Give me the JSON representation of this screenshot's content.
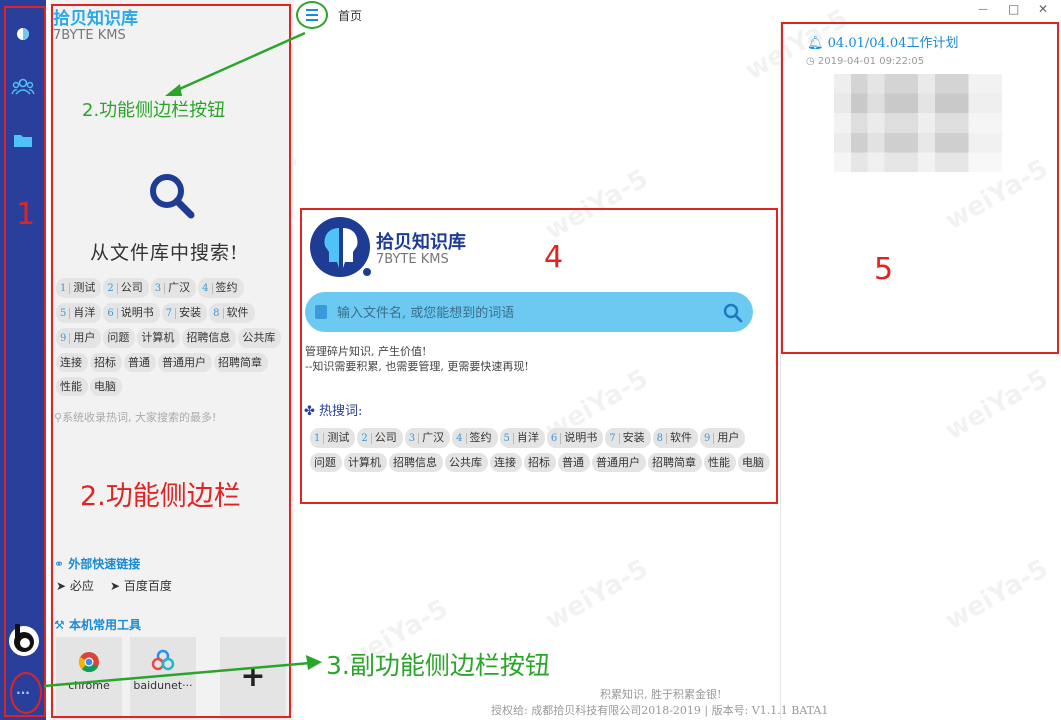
{
  "rail": {
    "icons": [
      "brain-icon",
      "users-icon",
      "folder-icon"
    ],
    "number": "1",
    "more_label": "···"
  },
  "panel": {
    "app_title": "拾贝知识库",
    "app_subtitle": "7BYTE KMS",
    "search_title": "从文件库中搜索!",
    "tags": [
      {
        "n": "1",
        "t": "测试"
      },
      {
        "n": "2",
        "t": "公司"
      },
      {
        "n": "3",
        "t": "广汉"
      },
      {
        "n": "4",
        "t": "签约"
      },
      {
        "n": "5",
        "t": "肖洋"
      },
      {
        "n": "6",
        "t": "说明书"
      },
      {
        "n": "7",
        "t": "安装"
      },
      {
        "n": "8",
        "t": "软件"
      },
      {
        "n": "9",
        "t": "用户"
      },
      {
        "n": "",
        "t": "问题"
      },
      {
        "n": "",
        "t": "计算机"
      },
      {
        "n": "",
        "t": "招聘信息"
      },
      {
        "n": "",
        "t": "公共库"
      },
      {
        "n": "",
        "t": "连接"
      },
      {
        "n": "",
        "t": "招标"
      },
      {
        "n": "",
        "t": "普通"
      },
      {
        "n": "",
        "t": "普通用户"
      },
      {
        "n": "",
        "t": "招聘简章"
      },
      {
        "n": "",
        "t": "性能"
      },
      {
        "n": "",
        "t": "电脑"
      }
    ],
    "hint": "系统收录热词, 大家搜索的最多!",
    "annotation_label": "2.功能侧边栏",
    "links_title": "外部快速链接",
    "links": [
      "必应",
      "百度百度"
    ],
    "tools_title": "本机常用工具",
    "tools": [
      "chrome",
      "baidunet···"
    ],
    "add_label": "+"
  },
  "header": {
    "title": "首页",
    "window_controls": [
      "—",
      "□",
      "✕"
    ]
  },
  "main": {
    "logo_title": "拾贝知识库",
    "logo_subtitle": "7BYTE KMS",
    "search_placeholder": "输入文件名, 或您能想到的词语",
    "slogan1": "管理碎片知识, 产生价值!",
    "slogan2": "--知识需要积累, 也需要管理, 更需要快速再现!",
    "hot_title": "热搜词:",
    "number": "4",
    "tags": [
      {
        "n": "1",
        "t": "测试"
      },
      {
        "n": "2",
        "t": "公司"
      },
      {
        "n": "3",
        "t": "广汉"
      },
      {
        "n": "4",
        "t": "签约"
      },
      {
        "n": "5",
        "t": "肖洋"
      },
      {
        "n": "6",
        "t": "说明书"
      },
      {
        "n": "7",
        "t": "安装"
      },
      {
        "n": "8",
        "t": "软件"
      },
      {
        "n": "9",
        "t": "用户"
      },
      {
        "n": "",
        "t": "问题"
      },
      {
        "n": "",
        "t": "计算机"
      },
      {
        "n": "",
        "t": "招聘信息"
      },
      {
        "n": "",
        "t": "公共库"
      },
      {
        "n": "",
        "t": "连接"
      },
      {
        "n": "",
        "t": "招标"
      },
      {
        "n": "",
        "t": "普通"
      },
      {
        "n": "",
        "t": "普通用户"
      },
      {
        "n": "",
        "t": "招聘简章"
      },
      {
        "n": "",
        "t": "性能"
      },
      {
        "n": "",
        "t": "电脑"
      }
    ]
  },
  "right": {
    "notice_title": "04.01/04.04工作计划",
    "notice_time": "2019-04-01 09:22:05",
    "number": "5"
  },
  "annotations": {
    "nav_button": "2.功能侧边栏按钮",
    "sub_button": "3.副功能侧边栏按钮"
  },
  "footer": {
    "line1": "积累知识, 胜于积累金银!",
    "line2": "授权给: 成都拾贝科技有限公司2018-2019 | 版本号: V1.1.1 BATA1"
  },
  "watermark": "weiYa-5",
  "colors": {
    "rail": "#2a3e9c",
    "accent": "#1a8ad4",
    "annotation_red": "#e02424",
    "annotation_green": "#2aa52a",
    "search": "#6ccaf2"
  }
}
